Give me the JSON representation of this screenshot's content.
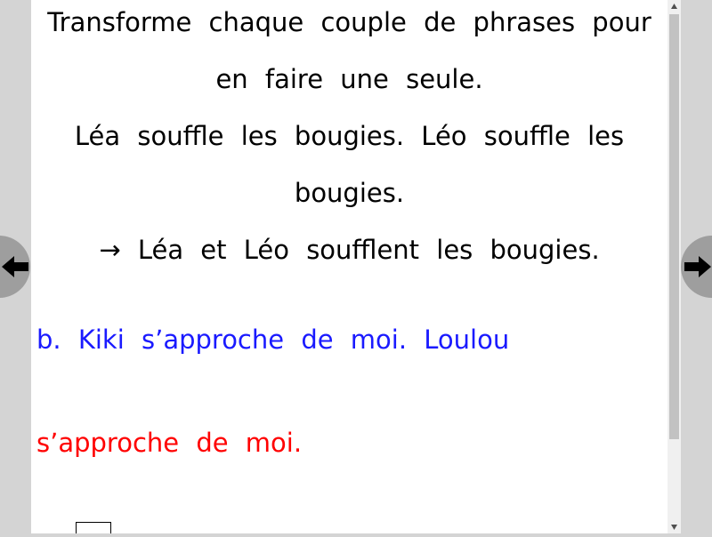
{
  "lesson": {
    "instruction_line1": "Transforme chaque couple de phrases pour",
    "instruction_line2": "en faire une seule.",
    "example_line1": "Léa souffle les bougies. Léo souffle les",
    "example_line2": "bougies.",
    "example_answer": "→ Léa et Léo soufflent les bougies.",
    "exercise_line1": "b. Kiki s’approche de moi. Loulou",
    "exercise_line2": "s’approche de moi."
  },
  "colors": {
    "exercise_blue": "#1a1aff",
    "exercise_red": "#ff0000",
    "nav_button": "#9e9e9e"
  },
  "icons": {
    "prev": "arrow-left-icon",
    "next": "arrow-right-icon"
  }
}
